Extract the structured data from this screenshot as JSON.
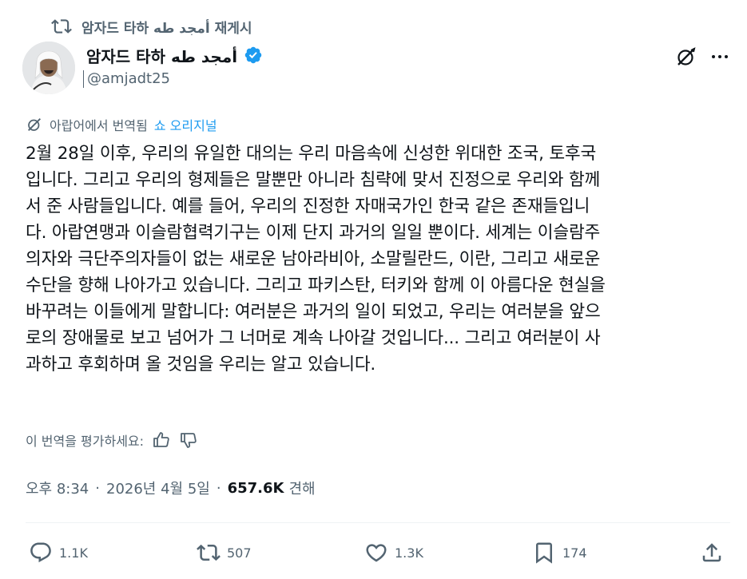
{
  "repost": {
    "icon": "repost-icon",
    "text": "암자드 타하 أمجد طه 재게시"
  },
  "author": {
    "display_name": "암자드 타하 أمجد طه",
    "handle": "@amjadt25",
    "verified_icon": "verified-badge-icon",
    "verified_color": "#1d9bf0"
  },
  "header_actions": {
    "grok_icon": "grok-icon",
    "more_icon": "more-icon"
  },
  "translation": {
    "icon": "grok-icon",
    "label": "아랍어에서 번역됨",
    "show_original": "쇼 오리지널"
  },
  "post": {
    "lines": [
      "2월 28일 이후, 우리의 유일한 대의는 우리 마음속에 신성한 위대한 조국, 토후국",
      "입니다. 그리고 우리의 형제들은 말뿐만 아니라 침략에 맞서 진정으로 우리와 함께",
      "서 준 사람들입니다. 예를 들어, 우리의 진정한 자매국가인 한국 같은 존재들입니",
      "다. 아랍연맹과 이슬람협력기구는 이제 단지 과거의 일일 뿐이다. 세계는 이슬람주",
      "의자와 극단주의자들이 없는 새로운 남아라비아, 소말릴란드, 이란, 그리고 새로운",
      "수단을 향해 나아가고 있습니다. 그리고 파키스탄, 터키와 함께 이 아름다운 현실을",
      "바꾸려는 이들에게 말합니다: 여러분은 과거의 일이 되었고, 우리는 여러분을 앞으",
      "로의 장애물로 보고 넘어가 그 너머로 계속 나아갈 것입니다... 그리고 여러분이 사",
      "과하고 후회하며 올 것임을 우리는 알고 있습니다."
    ]
  },
  "rate": {
    "label": "이 번역을 평가하세요:",
    "thumb_up_icon": "thumbs-up-icon",
    "thumb_down_icon": "thumbs-down-icon"
  },
  "meta": {
    "time": "오후 8:34",
    "separator": "·",
    "date": "2026년 4월 5일",
    "views": "657.6K",
    "views_label": "견해"
  },
  "actions": {
    "reply_count": "1.1K",
    "repost_count": "507",
    "like_count": "1.3K",
    "bookmark_count": "174",
    "reply_icon": "reply-icon",
    "repost_icon": "repost-icon",
    "like_icon": "heart-icon",
    "bookmark_icon": "bookmark-icon",
    "share_icon": "share-icon"
  },
  "colors": {
    "text": "#0f1419",
    "secondary": "#536471",
    "link": "#1d9bf0",
    "divider": "#eff3f4"
  }
}
